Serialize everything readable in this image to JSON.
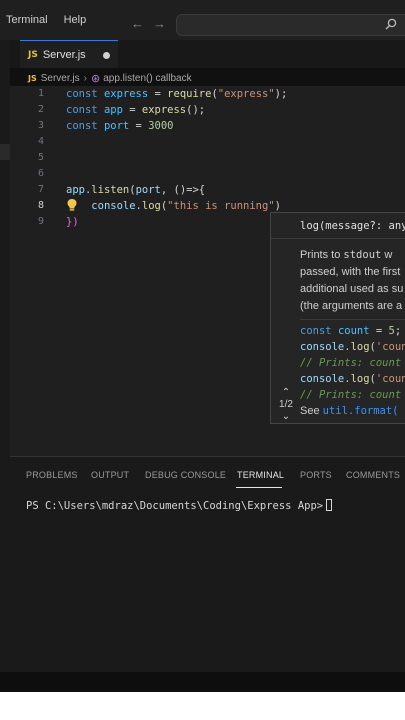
{
  "menu": {
    "items": [
      "Terminal",
      "Help"
    ]
  },
  "tab": {
    "label": "Server.js",
    "file_icon": "JS",
    "modified": true
  },
  "breadcrumb": {
    "file": "Server.js",
    "symbol": "app.listen() callback"
  },
  "editor": {
    "line_numbers": [
      "1",
      "2",
      "3",
      "4",
      "5",
      "6",
      "7",
      "8",
      "9"
    ],
    "active_line": "8",
    "lines": [
      {
        "kw": "const ",
        "name": "express",
        "op": " = ",
        "fn": "require",
        "open": "(",
        "str": "\"express\"",
        "close": ");"
      },
      {
        "kw": "const ",
        "name": "app",
        "op": " = ",
        "fn": "express",
        "open": "(",
        "str": "",
        "close": ");"
      },
      {
        "kw": "const ",
        "name": "port",
        "op": " = ",
        "num": "3000"
      },
      {
        "text": "app.listen(port, ()=>{",
        "a": "app.",
        "b": "listen",
        "c": "(",
        "d": "port",
        "e": ", ()=>{"
      },
      {
        "a": "console.",
        "b": "log",
        "c": "(",
        "str": "\"this is running\"",
        "d": ")"
      },
      {
        "text": "})"
      }
    ]
  },
  "hover": {
    "signature": "log(message?: any",
    "doc_line1_a": "Prints to ",
    "doc_line1_b": "stdout",
    "doc_line1_c": " w",
    "doc_line2": "passed, with the first",
    "doc_line3": "additional used as su",
    "doc_line4": "(the arguments are a",
    "code1_kw": "const ",
    "code1_var": "count",
    "code1_op": " = ",
    "code1_num": "5",
    "code1_end": ";",
    "code2_a": "console.",
    "code2_b": "log",
    "code2_c": "(",
    "code2_str": "'coun",
    "code3": "// Prints: count",
    "code4_a": "console.",
    "code4_b": "log",
    "code4_c": "(",
    "code4_str": "'coun",
    "code5": "// Prints: count",
    "pager": "1/2",
    "see_label": "See ",
    "see_link": "util.format("
  },
  "panel": {
    "tabs": [
      "PROBLEMS",
      "OUTPUT",
      "DEBUG CONSOLE",
      "TERMINAL",
      "PORTS",
      "COMMENTS"
    ],
    "active_tab": "TERMINAL",
    "prompt": "PS C:\\Users\\mdraz\\Documents\\Coding\\Express App>"
  },
  "colors": {
    "keyword": "#569cd6",
    "variable": "#4fc1ff",
    "function": "#dcdcaa",
    "string": "#ce9178",
    "number": "#b5cea8",
    "accent": "#3c7ad3"
  }
}
